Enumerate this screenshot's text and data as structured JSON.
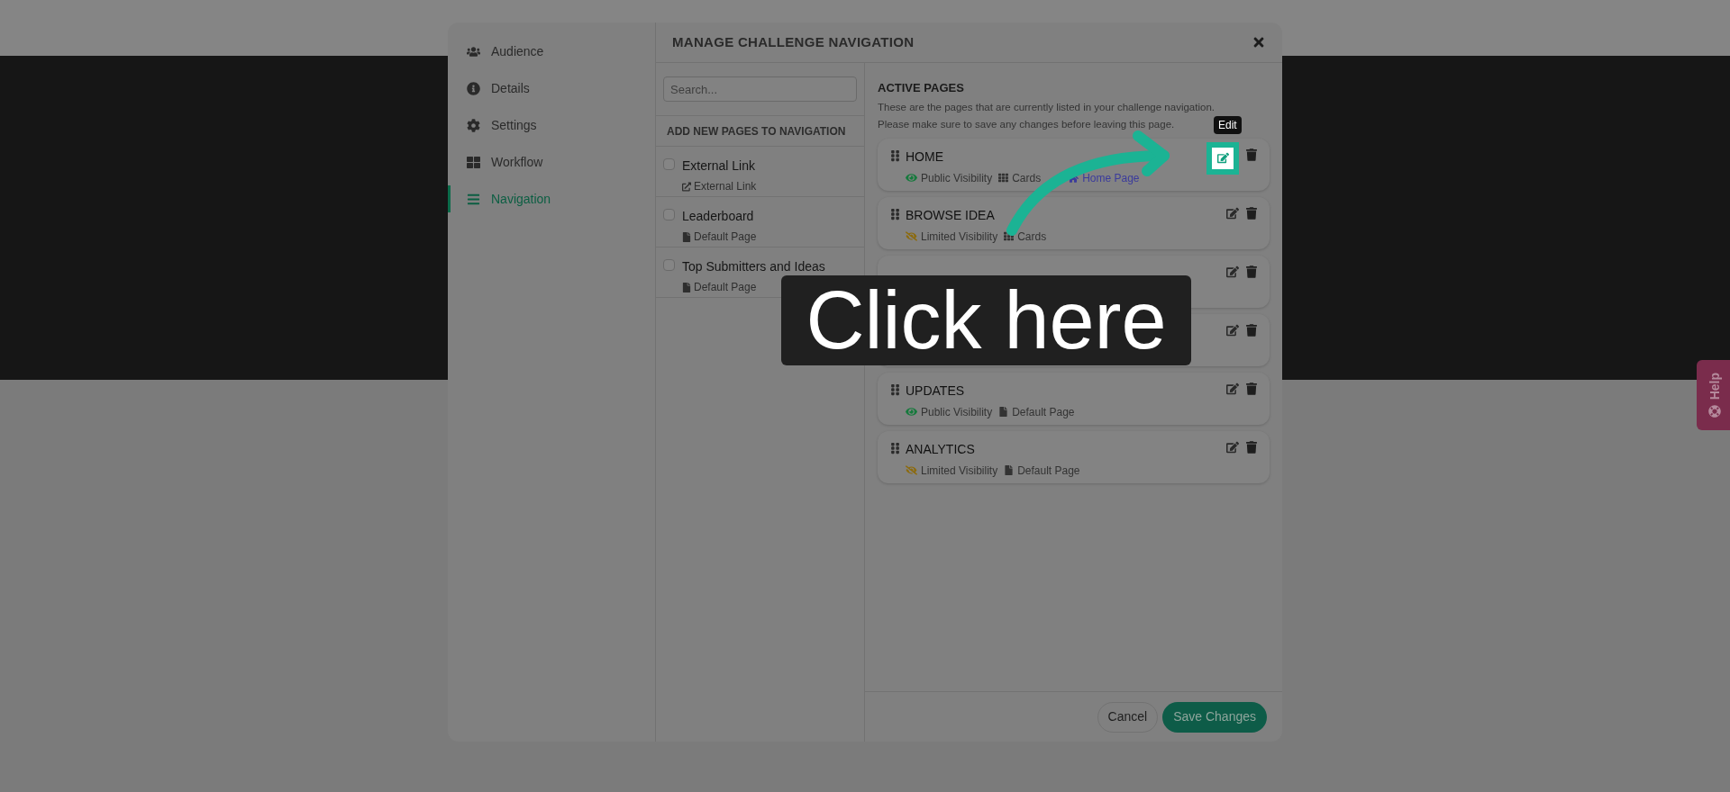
{
  "sidebar": {
    "items": [
      {
        "label": "Audience",
        "kind": "users",
        "selected": false
      },
      {
        "label": "Details",
        "kind": "info",
        "selected": false
      },
      {
        "label": "Settings",
        "kind": "gear",
        "selected": false
      },
      {
        "label": "Workflow",
        "kind": "blocks",
        "selected": false
      },
      {
        "label": "Navigation",
        "kind": "menu",
        "selected": true
      }
    ]
  },
  "modal": {
    "title": "MANAGE CHALLENGE NAVIGATION"
  },
  "available": {
    "search": {
      "placeholder": "Search..."
    },
    "heading": "ADD NEW PAGES TO NAVIGATION",
    "items": [
      {
        "title": "External Link",
        "checked": false,
        "type": {
          "kind": "link",
          "label": "External Link"
        }
      },
      {
        "title": "Leaderboard",
        "checked": false,
        "type": {
          "kind": "page",
          "label": "Default Page"
        }
      },
      {
        "title": "Top Submitters and Ideas",
        "checked": false,
        "type": {
          "kind": "page",
          "label": "Default Page"
        }
      }
    ]
  },
  "active": {
    "heading": "ACTIVE PAGES",
    "description": [
      "These are the pages that are currently listed in your challenge navigation.",
      "Please make sure to save any changes before leaving this page."
    ],
    "pages": [
      {
        "title": "HOME",
        "visibility": {
          "kind": "public",
          "label": "Public Visibility"
        },
        "layout": {
          "kind": "cards",
          "label": "Cards"
        },
        "home": "Home Page"
      },
      {
        "title": "BROWSE IDEA",
        "visibility": {
          "kind": "limited",
          "label": "Limited Visibility"
        },
        "layout": {
          "kind": "cards",
          "label": "Cards"
        }
      },
      {
        "covered": true
      },
      {
        "covered": true
      },
      {
        "title": "UPDATES",
        "visibility": {
          "kind": "public",
          "label": "Public Visibility"
        },
        "layout": {
          "kind": "page",
          "label": "Default Page"
        }
      },
      {
        "title": "ANALYTICS",
        "visibility": {
          "kind": "limited",
          "label": "Limited Visibility"
        },
        "layout": {
          "kind": "page",
          "label": "Default Page"
        }
      }
    ]
  },
  "footer": {
    "cancel": "Cancel",
    "save": "Save Changes"
  },
  "tutorial": {
    "tooltip": "Edit",
    "callout": "Click here"
  },
  "help": {
    "label": "Help"
  }
}
